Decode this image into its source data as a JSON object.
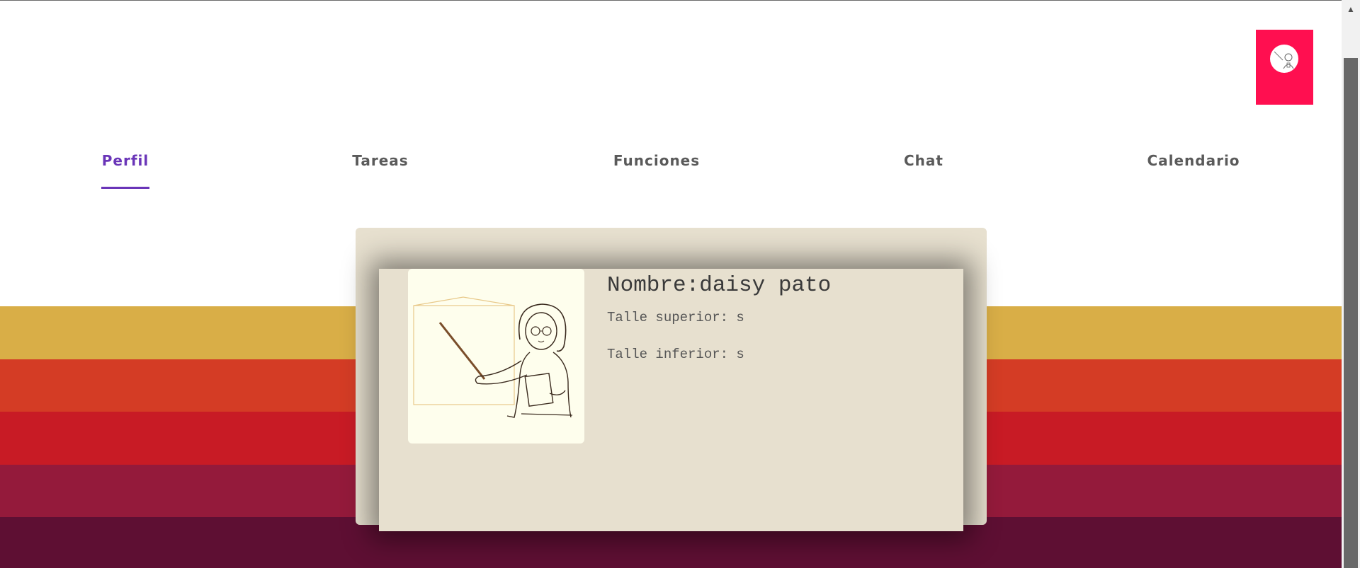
{
  "tabs": [
    {
      "label": "Perfil",
      "active": true
    },
    {
      "label": "Tareas",
      "active": false
    },
    {
      "label": "Funciones",
      "active": false
    },
    {
      "label": "Chat",
      "active": false
    },
    {
      "label": "Calendario",
      "active": false
    }
  ],
  "profile": {
    "name_line": "Nombre:daisy pato",
    "upper_size_line": "Talle superior: s",
    "lower_size_line": "Talle inferior: s"
  },
  "icons": {
    "avatar": "teacher-avatar-icon",
    "profile_image": "teacher-illustration-icon",
    "scroll_up": "scroll-up-arrow-icon"
  },
  "colors": {
    "accent": "#6a35b8",
    "avatar_bg": "#ff0f50",
    "card_bg": "#e7e0cf",
    "stripes": [
      "#d9ae47",
      "#d43c25",
      "#c81b25",
      "#941a3b",
      "#5e0f33"
    ]
  }
}
